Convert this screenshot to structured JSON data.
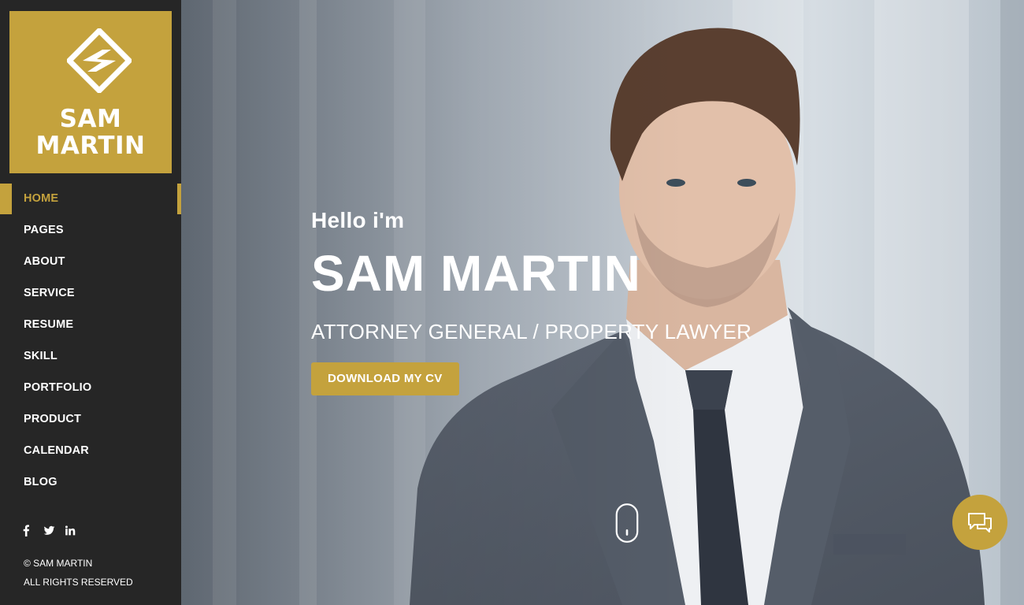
{
  "brand": {
    "name_line1": "SAM",
    "name_line2": "MARTIN",
    "accent_color": "#c4a23d",
    "logo_icon": "diamond-lightning-icon"
  },
  "nav": {
    "items": [
      {
        "label": "HOME",
        "active": true
      },
      {
        "label": "PAGES",
        "active": false
      },
      {
        "label": "ABOUT",
        "active": false
      },
      {
        "label": "SERVICE",
        "active": false
      },
      {
        "label": "RESUME",
        "active": false
      },
      {
        "label": "SKILL",
        "active": false
      },
      {
        "label": "PORTFOLIO",
        "active": false
      },
      {
        "label": "PRODUCT",
        "active": false
      },
      {
        "label": "CALENDAR",
        "active": false
      },
      {
        "label": "BLOG",
        "active": false
      }
    ]
  },
  "social": {
    "icons": [
      "facebook-icon",
      "twitter-icon",
      "linkedin-icon"
    ]
  },
  "footer": {
    "copyright": "© SAM MARTIN",
    "rights": "ALL RIGHTS RESERVED"
  },
  "hero": {
    "greeting": "Hello i'm",
    "name": "SAM MARTIN",
    "role": "ATTORNEY GENERAL / PROPERTY LAWYER",
    "cta_label": "DOWNLOAD MY CV",
    "scroll_icon": "mouse-scroll-icon",
    "chat_icon": "chat-bubbles-icon"
  },
  "colors": {
    "sidebar_bg": "#262626",
    "accent": "#c4a23d",
    "text": "#ffffff"
  }
}
